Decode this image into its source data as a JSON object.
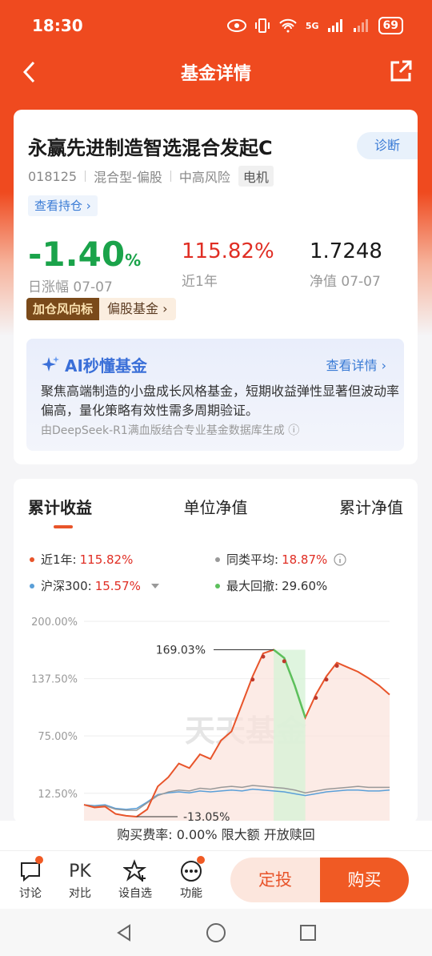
{
  "status": {
    "time": "18:30",
    "battery": "69",
    "network": "5G"
  },
  "nav": {
    "title": "基金详情"
  },
  "fund": {
    "name": "永赢先进制造智选混合发起C",
    "diagnose": "诊断",
    "code": "018125",
    "type": "混合型-偏股",
    "risk": "中高风险",
    "tag": "电机",
    "holdings": "查看持仓 ›"
  },
  "stats": {
    "daily_value": "-1.40",
    "daily_unit": "%",
    "daily_label": "日涨幅 07-07",
    "year_value": "115.82%",
    "year_label": "近1年",
    "nav_value": "1.7248",
    "nav_label": "净值 07-07"
  },
  "wind": {
    "left": "加仓风向标",
    "right": "偏股基金 ›"
  },
  "ai": {
    "title": "AI秒懂基金",
    "link": "查看详情 ›",
    "text": "聚焦高端制造的小盘成长风格基金，短期收益弹性显著但波动率偏高，量化策略有效性需多周期验证。",
    "source": "由DeepSeek-R1满血版结合专业基金数据库生成 ⓘ"
  },
  "chart_tabs": [
    "累计收益",
    "单位净值",
    "累计净值"
  ],
  "legend": {
    "year_label": "近1年:",
    "year_value": "115.82%",
    "peer_label": "同类平均:",
    "peer_value": "18.87%",
    "hs_label": "沪深300:",
    "hs_value": "15.57%",
    "dd_label": "最大回撤:",
    "dd_value": "29.60%"
  },
  "colors": {
    "fund": "#e8542a",
    "peer": "#999999",
    "hs300": "#5a9fd8",
    "drawdown": "#5cc05c",
    "accent": "#f05a24"
  },
  "chart_data": {
    "type": "line",
    "yticks": [
      "200.00%",
      "137.50%",
      "75.00%",
      "12.50%"
    ],
    "ylim": [
      -20,
      200
    ],
    "annotations": [
      "169.03%",
      "-13.05%"
    ],
    "watermark": "天天基金",
    "series": [
      {
        "name": "近1年",
        "values": [
          0,
          -3,
          -2,
          -10,
          -12,
          -13,
          -5,
          20,
          30,
          45,
          40,
          55,
          50,
          70,
          80,
          110,
          140,
          165,
          169,
          160,
          130,
          95,
          120,
          140,
          155,
          150,
          145,
          138,
          130,
          120
        ]
      },
      {
        "name": "同类平均",
        "values": [
          0,
          -2,
          -1,
          -5,
          -6,
          -6,
          2,
          10,
          14,
          16,
          15,
          18,
          17,
          19,
          20,
          19,
          21,
          20,
          19,
          18,
          16,
          13,
          15,
          17,
          18,
          19,
          20,
          19,
          19,
          19
        ]
      },
      {
        "name": "沪深300",
        "values": [
          0,
          -1,
          0,
          -4,
          -5,
          -4,
          3,
          11,
          13,
          14,
          13,
          15,
          14,
          15,
          16,
          15,
          17,
          16,
          15,
          14,
          12,
          10,
          12,
          14,
          15,
          16,
          16,
          15,
          15,
          16
        ]
      }
    ]
  },
  "fee": "购买费率: 0.00% 限大额 开放赎回",
  "actions": [
    {
      "label": "讨论"
    },
    {
      "label": "对比",
      "glyph": "PK"
    },
    {
      "label": "设自选"
    },
    {
      "label": "功能"
    }
  ],
  "buttons": {
    "fixed": "定投",
    "buy": "购买"
  }
}
